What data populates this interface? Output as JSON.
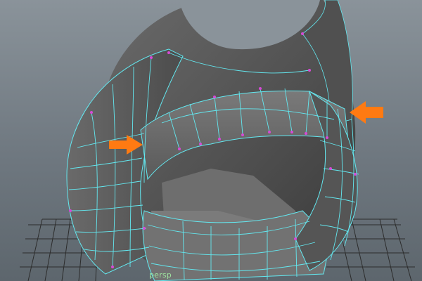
{
  "viewport": {
    "camera_label": "persp"
  },
  "colors": {
    "background": "#6e7880",
    "mesh_fill": "#5b5b5b",
    "mesh_shadow": "#3f3f3f",
    "wireframe": "#63e8f0",
    "vertex": "#d64ad6",
    "grid": "#2c2c2c",
    "arrow": "#ff7a12",
    "camera_label": "#9fe6a0"
  },
  "icons": {
    "arrow_left": "arrow-right-icon",
    "arrow_right": "arrow-left-icon"
  }
}
